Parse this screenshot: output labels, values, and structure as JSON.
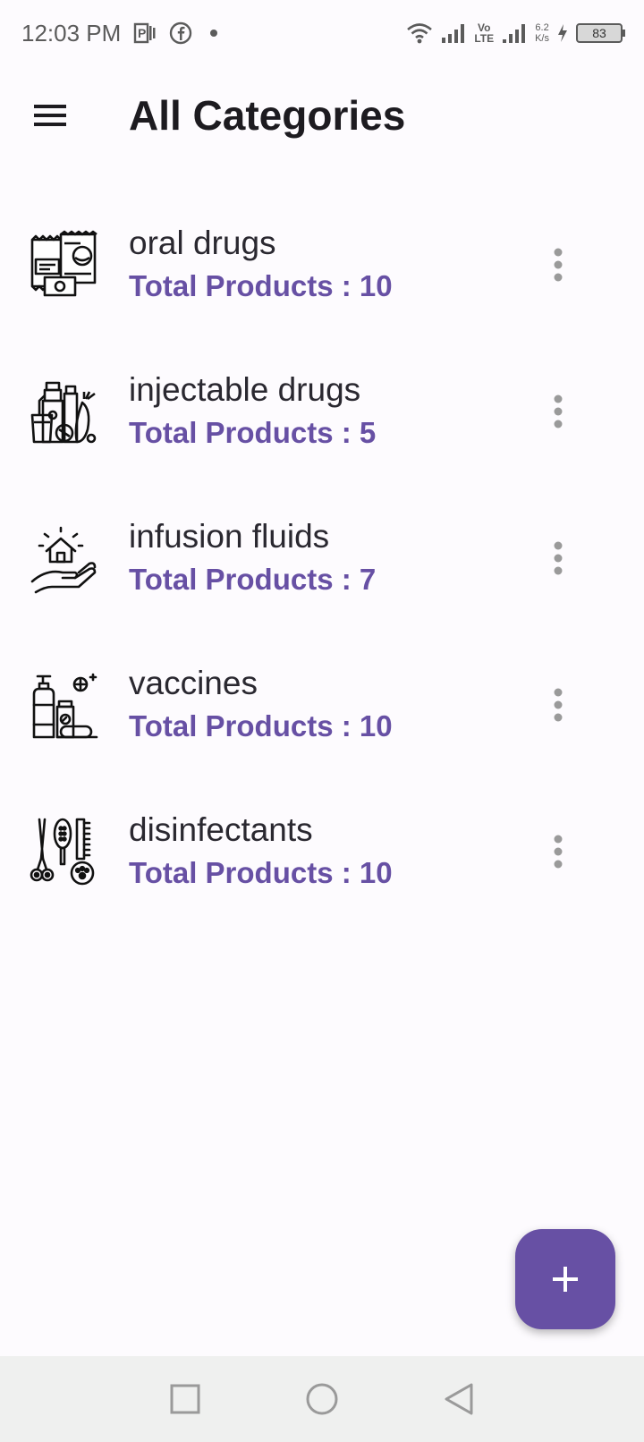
{
  "status_bar": {
    "time": "12:03 PM",
    "network_speed_value": "6.2",
    "network_speed_unit": "K/s",
    "battery": "83",
    "volte_top": "Vo",
    "volte_bottom": "LTE"
  },
  "app_bar": {
    "title": "All Categories",
    "menu_icon": "hamburger-menu-icon"
  },
  "categories": [
    {
      "name": "oral drugs",
      "count_label": "Total Products : 10",
      "icon": "snack-packages-icon"
    },
    {
      "name": "injectable drugs",
      "count_label": "Total Products : 5",
      "icon": "groceries-bottles-icon"
    },
    {
      "name": "infusion fluids",
      "count_label": "Total Products : 7",
      "icon": "house-on-hand-icon"
    },
    {
      "name": "vaccines",
      "count_label": "Total Products : 10",
      "icon": "soap-dispenser-icon"
    },
    {
      "name": "disinfectants",
      "count_label": "Total Products : 10",
      "icon": "pet-grooming-tools-icon"
    }
  ],
  "fab": {
    "symbol": "+",
    "icon": "add-icon"
  },
  "colors": {
    "accent": "#6750a4",
    "background": "#fdfbfe",
    "nav_bar": "#eff0ef"
  }
}
